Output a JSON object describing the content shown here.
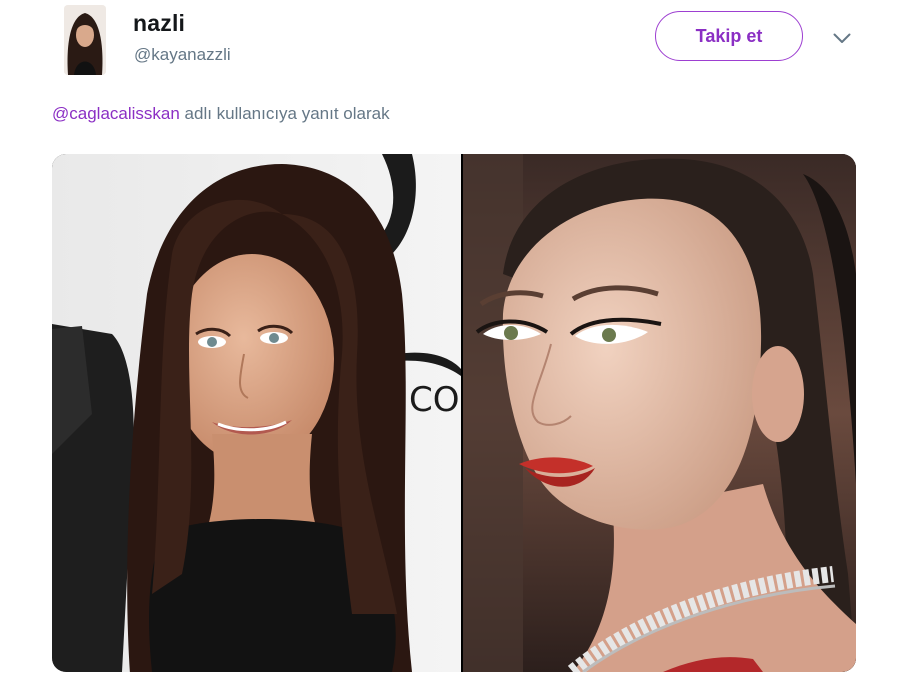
{
  "user": {
    "display_name": "nazli",
    "handle": "@kayanazzli"
  },
  "actions": {
    "follow_label": "Takip et",
    "more_icon": "chevron-down-icon"
  },
  "reply": {
    "mention": "@caglacalisskan",
    "suffix": " adlı kullanıcıya yanıt olarak"
  },
  "media": {
    "photo_count": 2,
    "left_photo_text": "COR"
  },
  "colors": {
    "accent": "#8b2fc4",
    "secondary_text": "#657786",
    "primary_text": "#14171a"
  }
}
